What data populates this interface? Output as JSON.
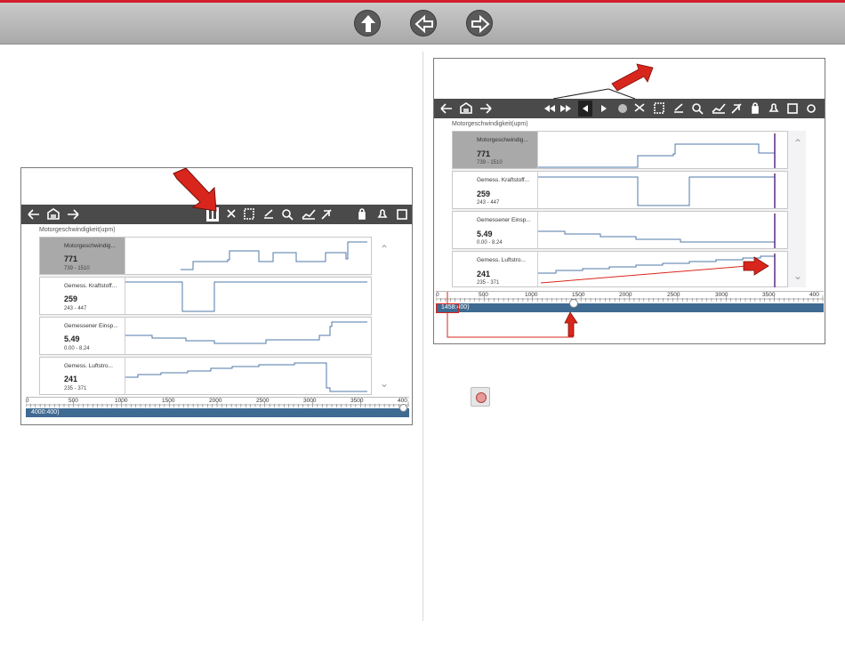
{
  "left_screen": {
    "subtitle": "Motorgeschwindigkeit(upm)",
    "rows": [
      {
        "name": "Motorgeschwindig...",
        "value": "771",
        "range": "739 - 1510"
      },
      {
        "name": "Gemess. Kraftstoff...",
        "value": "259",
        "range": "243 - 447"
      },
      {
        "name": "Gemessener Einsp...",
        "value": "5.49",
        "range": "0.00 - 8.24"
      },
      {
        "name": "Gemess. Luftstro...",
        "value": "241",
        "range": "235 - 371"
      }
    ],
    "scale_ticks": [
      "0",
      "500",
      "1000",
      "1500",
      "2000",
      "2500",
      "3000",
      "3500",
      "400"
    ],
    "position_label": "4000:400)"
  },
  "right_screen": {
    "subtitle": "Motorgeschwindigkeit(upm)",
    "rows": [
      {
        "name": "Motorgeschwindig...",
        "value": "771",
        "range": "739 - 1510"
      },
      {
        "name": "Gemess. Kraftstoff...",
        "value": "259",
        "range": "243 - 447"
      },
      {
        "name": "Gemessener Einsp...",
        "value": "5.49",
        "range": "0.00 - 8.24"
      },
      {
        "name": "Gemess. Luftstro...",
        "value": "241",
        "range": "235 - 371"
      }
    ],
    "scale_ticks": [
      "0",
      "500",
      "1000",
      "1500",
      "2000",
      "2500",
      "3000",
      "3500",
      "400"
    ],
    "position_label": "1458:400)"
  },
  "colors": {
    "accent_red": "#d21f2b",
    "toolbar": "#4a4a4a",
    "timeline_blue": "#3f6a92",
    "trace": "#4f79a8"
  },
  "icons": [
    "up-arrow-icon",
    "back-arrow-icon",
    "forward-arrow-icon",
    "pause-icon",
    "record-icon"
  ]
}
